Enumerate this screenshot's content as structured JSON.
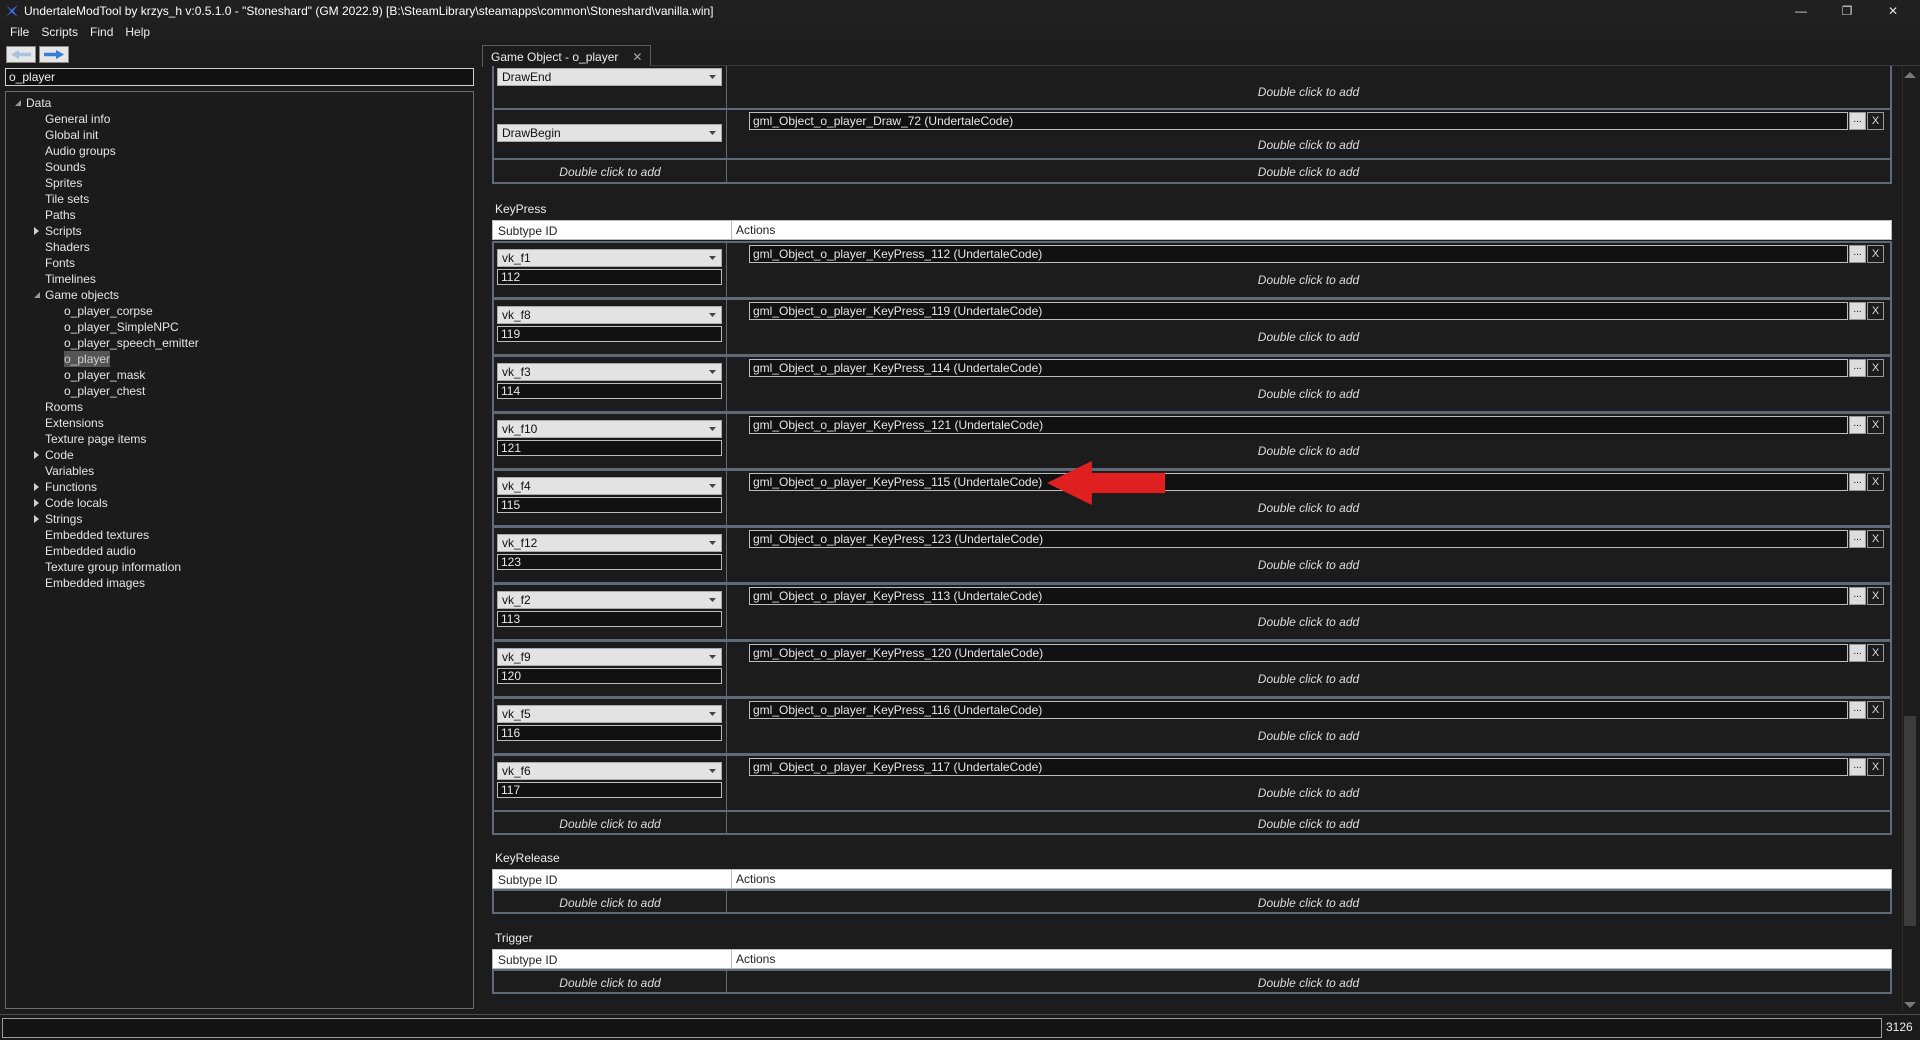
{
  "window": {
    "title": "UndertaleModTool by krzys_h v:0.5.1.0 - \"Stoneshard\" (GM 2022.9) [B:\\SteamLibrary\\steamapps\\common\\Stoneshard\\vanilla.win]",
    "minimize": "—",
    "restore": "❐",
    "close": "✕"
  },
  "menu": [
    "File",
    "Scripts",
    "Find",
    "Help"
  ],
  "search": {
    "value": "o_player"
  },
  "tree": [
    {
      "label": "Data",
      "level": 0,
      "toggle": "expanded"
    },
    {
      "label": "General info",
      "level": 1
    },
    {
      "label": "Global init",
      "level": 1
    },
    {
      "label": "Audio groups",
      "level": 1
    },
    {
      "label": "Sounds",
      "level": 1
    },
    {
      "label": "Sprites",
      "level": 1
    },
    {
      "label": "Tile sets",
      "level": 1
    },
    {
      "label": "Paths",
      "level": 1
    },
    {
      "label": "Scripts",
      "level": 1,
      "toggle": "collapsed"
    },
    {
      "label": "Shaders",
      "level": 1
    },
    {
      "label": "Fonts",
      "level": 1
    },
    {
      "label": "Timelines",
      "level": 1
    },
    {
      "label": "Game objects",
      "level": 1,
      "toggle": "expanded"
    },
    {
      "label": "o_player_corpse",
      "level": 2
    },
    {
      "label": "o_player_SimpleNPC",
      "level": 2
    },
    {
      "label": "o_player_speech_emitter",
      "level": 2
    },
    {
      "label": "o_player",
      "level": 2,
      "selected": true
    },
    {
      "label": "o_player_mask",
      "level": 2
    },
    {
      "label": "o_player_chest",
      "level": 2
    },
    {
      "label": "Rooms",
      "level": 1
    },
    {
      "label": "Extensions",
      "level": 1
    },
    {
      "label": "Texture page items",
      "level": 1
    },
    {
      "label": "Code",
      "level": 1,
      "toggle": "collapsed"
    },
    {
      "label": "Variables",
      "level": 1
    },
    {
      "label": "Functions",
      "level": 1,
      "toggle": "collapsed"
    },
    {
      "label": "Code locals",
      "level": 1,
      "toggle": "collapsed"
    },
    {
      "label": "Strings",
      "level": 1,
      "toggle": "collapsed"
    },
    {
      "label": "Embedded textures",
      "level": 1
    },
    {
      "label": "Embedded audio",
      "level": 1
    },
    {
      "label": "Texture group information",
      "level": 1
    },
    {
      "label": "Embedded images",
      "level": 1
    }
  ],
  "tab": {
    "label": "Game Object - o_player",
    "close": "✕"
  },
  "double_click_to_add": "Double click to add",
  "draw_rows": {
    "drawend": "DrawEnd",
    "drawbegin": "DrawBegin",
    "drawbegin_code": "gml_Object_o_player_Draw_72 (UndertaleCode)"
  },
  "keypress": {
    "title": "KeyPress",
    "col_subtype": "Subtype ID",
    "col_actions": "Actions",
    "rows": [
      {
        "key": "vk_f1",
        "id": "112",
        "code": "gml_Object_o_player_KeyPress_112 (UndertaleCode)"
      },
      {
        "key": "vk_f8",
        "id": "119",
        "code": "gml_Object_o_player_KeyPress_119 (UndertaleCode)"
      },
      {
        "key": "vk_f3",
        "id": "114",
        "code": "gml_Object_o_player_KeyPress_114 (UndertaleCode)"
      },
      {
        "key": "vk_f10",
        "id": "121",
        "code": "gml_Object_o_player_KeyPress_121 (UndertaleCode)"
      },
      {
        "key": "vk_f4",
        "id": "115",
        "code": "gml_Object_o_player_KeyPress_115 (UndertaleCode)"
      },
      {
        "key": "vk_f12",
        "id": "123",
        "code": "gml_Object_o_player_KeyPress_123 (UndertaleCode)"
      },
      {
        "key": "vk_f2",
        "id": "113",
        "code": "gml_Object_o_player_KeyPress_113 (UndertaleCode)"
      },
      {
        "key": "vk_f9",
        "id": "120",
        "code": "gml_Object_o_player_KeyPress_120 (UndertaleCode)"
      },
      {
        "key": "vk_f5",
        "id": "116",
        "code": "gml_Object_o_player_KeyPress_116 (UndertaleCode)"
      },
      {
        "key": "vk_f6",
        "id": "117",
        "code": "gml_Object_o_player_KeyPress_117 (UndertaleCode)"
      }
    ]
  },
  "keyrelease": {
    "title": "KeyRelease",
    "col_subtype": "Subtype ID",
    "col_actions": "Actions"
  },
  "trigger": {
    "title": "Trigger",
    "col_subtype": "Subtype ID",
    "col_actions": "Actions"
  },
  "buttons": {
    "dots": "...",
    "remove": "X"
  },
  "statusbar": {
    "value": "3126"
  },
  "colors": {
    "background": "#1c1c1c",
    "row_border": "#5f6a78",
    "annotation_arrow": "#e02020"
  }
}
